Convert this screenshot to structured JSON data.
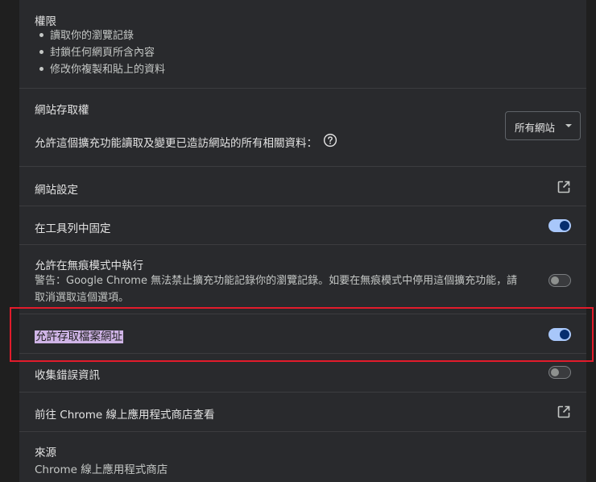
{
  "permissions": {
    "title": "權限",
    "items": [
      "讀取你的瀏覽記錄",
      "封鎖任何網頁所含內容",
      "修改你複製和貼上的資料"
    ]
  },
  "site_access": {
    "title": "網站存取權",
    "description": "允許這個擴充功能讀取及變更已造訪網站的所有相關資料：",
    "help_icon": "help-circle-icon",
    "select_value": "所有網站"
  },
  "site_settings": {
    "label": "網站設定",
    "icon": "open-in-new-icon"
  },
  "pin_toolbar": {
    "label": "在工具列中固定",
    "enabled": true
  },
  "incognito": {
    "label": "允許在無痕模式中執行",
    "warning_line1": "警告：Google Chrome 無法禁止擴充功能記錄你的瀏覽記錄。如要在無痕模式中停用這個擴充功能，請",
    "warning_line2": "取消選取這個選項。",
    "enabled": false
  },
  "file_urls": {
    "label": "允許存取檔案網址",
    "enabled": true
  },
  "error_collection": {
    "label": "收集錯誤資訊",
    "enabled": false
  },
  "webstore": {
    "label": "前往 Chrome 線上應用程式商店查看",
    "icon": "open-in-new-icon"
  },
  "source": {
    "title": "來源",
    "value": "Chrome 線上應用程式商店"
  },
  "colors": {
    "background": "#1f1f1f",
    "panel": "#292a2d",
    "toggle_on": "#a8c7fa",
    "highlight_box": "#e21b2b",
    "selection": "#cfb4e6"
  }
}
